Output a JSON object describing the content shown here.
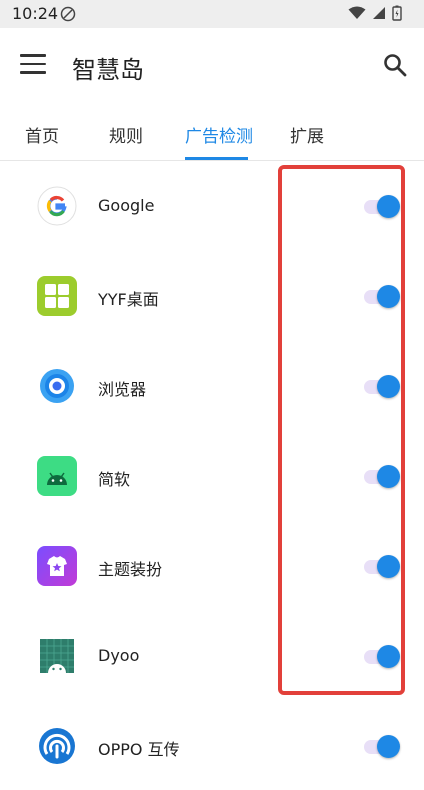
{
  "status_bar": {
    "time": "10:24"
  },
  "app_bar": {
    "title": "智慧岛"
  },
  "tabs": [
    {
      "label": "首页"
    },
    {
      "label": "规则"
    },
    {
      "label": "广告检测",
      "active": true
    },
    {
      "label": "扩展"
    }
  ],
  "apps": [
    {
      "name": "Google",
      "icon": "google-icon",
      "enabled": true
    },
    {
      "name": "YYF桌面",
      "icon": "yyf-launcher-icon",
      "enabled": true
    },
    {
      "name": "浏览器",
      "icon": "browser-icon",
      "enabled": true
    },
    {
      "name": "简软",
      "icon": "android-app-icon",
      "enabled": true
    },
    {
      "name": "主题装扮",
      "icon": "theme-store-icon",
      "enabled": true
    },
    {
      "name": "Dyoo",
      "icon": "dyoo-icon",
      "enabled": true
    },
    {
      "name": "OPPO 互传",
      "icon": "oppo-share-icon",
      "enabled": true
    }
  ],
  "colors": {
    "accent": "#1e88e5",
    "switch_track": "#e8dff7",
    "highlight": "#e2403a"
  }
}
